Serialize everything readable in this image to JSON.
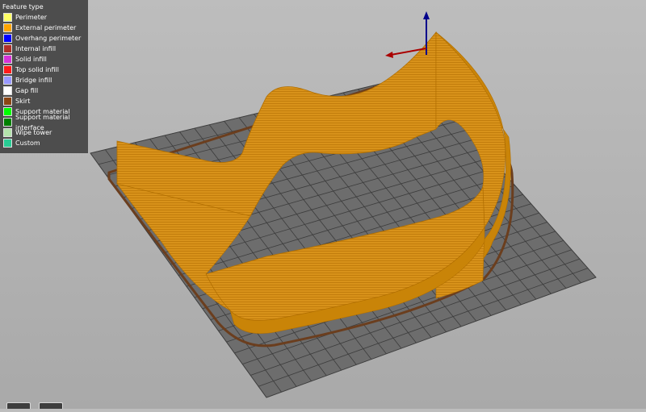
{
  "legend": {
    "title": "Feature type",
    "items": [
      {
        "label": "Perimeter",
        "color": "#ffff66"
      },
      {
        "label": "External perimeter",
        "color": "#ffa500"
      },
      {
        "label": "Overhang perimeter",
        "color": "#0000ff"
      },
      {
        "label": "Internal infill",
        "color": "#b03029"
      },
      {
        "label": "Solid infill",
        "color": "#d732d7"
      },
      {
        "label": "Top solid infill",
        "color": "#ff1a1a"
      },
      {
        "label": "Bridge infill",
        "color": "#9999ff"
      },
      {
        "label": "Gap fill",
        "color": "#ffffff"
      },
      {
        "label": "Skirt",
        "color": "#8b4513"
      },
      {
        "label": "Support material",
        "color": "#00ff00"
      },
      {
        "label": "Support material interface",
        "color": "#008000"
      },
      {
        "label": "Wipe tower",
        "color": "#b3e3ab"
      },
      {
        "label": "Custom",
        "color": "#28cc94"
      }
    ]
  },
  "scene": {
    "bed_color": "#6d6d6d",
    "grid_color": "#3a3a3a",
    "wall_color": "#d79112",
    "wall_dark": "#b06e00",
    "skirt_color": "#6b3e1e",
    "axis_z_color": "#00008b",
    "axis_x_color": "#aa0000"
  }
}
